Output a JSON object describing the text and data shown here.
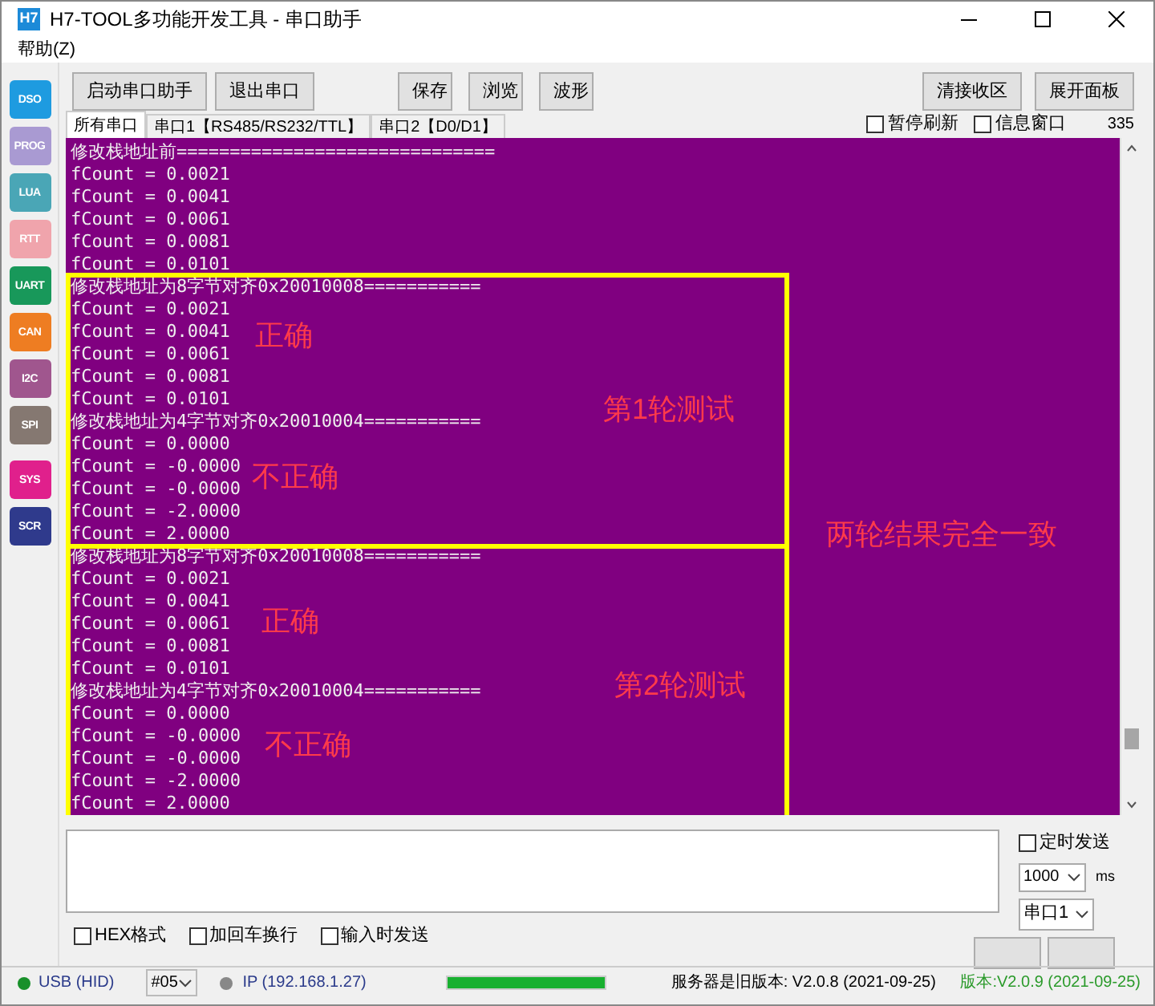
{
  "window": {
    "icon_text": "H7",
    "title": "H7-TOOL多功能开发工具 - 串口助手"
  },
  "menu": [
    "帮助(Z)"
  ],
  "sidebar": [
    {
      "label": "DSO",
      "color": "#1e9be0"
    },
    {
      "label": "PROG",
      "color": "#a99ad2"
    },
    {
      "label": "LUA",
      "color": "#4aa6b6"
    },
    {
      "label": "RTT",
      "color": "#f0a4ac"
    },
    {
      "label": "UART",
      "color": "#18985a"
    },
    {
      "label": "CAN",
      "color": "#ee7d22"
    },
    {
      "label": "I2C",
      "color": "#a0568e"
    },
    {
      "label": "SPI",
      "color": "#857871"
    },
    {
      "label": "SYS",
      "color": "#e0208c"
    },
    {
      "label": "SCR",
      "color": "#2f3a8c"
    }
  ],
  "toolbar": {
    "left": [
      "启动串口助手",
      "退出串口"
    ],
    "middle": [
      "保存",
      "浏览",
      "波形"
    ],
    "right": [
      "清接收区",
      "展开面板"
    ]
  },
  "tabs": [
    {
      "label": "所有串口",
      "selected": true
    },
    {
      "label": "串口1【RS485/RS232/TTL】",
      "selected": false
    },
    {
      "label": "串口2【D0/D1】",
      "selected": false
    }
  ],
  "view_options": [
    {
      "label": "暂停刷新",
      "checked": false
    },
    {
      "label": "信息窗口",
      "checked": false
    }
  ],
  "counter": "335",
  "terminal": {
    "lines": [
      "修改栈地址前==============================",
      "fCount = 0.0021",
      "fCount = 0.0041",
      "fCount = 0.0061",
      "fCount = 0.0081",
      "fCount = 0.0101",
      "修改栈地址为8字节对齐0x20010008===========",
      "fCount = 0.0021",
      "fCount = 0.0041",
      "fCount = 0.0061",
      "fCount = 0.0081",
      "fCount = 0.0101",
      "修改栈地址为4字节对齐0x20010004===========",
      "fCount = 0.0000",
      "fCount = -0.0000",
      "fCount = -0.0000",
      "fCount = -2.0000",
      "fCount = 2.0000",
      "修改栈地址为8字节对齐0x20010008===========",
      "fCount = 0.0021",
      "fCount = 0.0041",
      "fCount = 0.0061",
      "fCount = 0.0081",
      "fCount = 0.0101",
      "修改栈地址为4字节对齐0x20010004===========",
      "fCount = 0.0000",
      "fCount = -0.0000",
      "fCount = -0.0000",
      "fCount = -2.0000",
      "fCount = 2.0000"
    ],
    "annotations": [
      "正确",
      "第1轮测试",
      "不正确",
      "两轮结果完全一致",
      "正确",
      "第2轮测试",
      "不正确"
    ]
  },
  "send": {
    "timer": {
      "label": "定时发送",
      "checked": false
    },
    "interval": "1000",
    "unit": "ms",
    "port": "串口1"
  },
  "send_options": [
    {
      "label": "HEX格式",
      "checked": false
    },
    {
      "label": "加回车换行",
      "checked": false
    },
    {
      "label": "输入时发送",
      "checked": false
    }
  ],
  "status_bar": {
    "usb": {
      "label": "USB (HID)",
      "connected": true
    },
    "device": "#05",
    "ip": {
      "label": "IP (192.168.1.27)",
      "connected": false
    },
    "progress": {
      "level": 1
    },
    "server_version": "服务器是旧版本: V2.0.8 (2021-09-25)",
    "client_version": "版本:V2.0.9 (2021-09-25)"
  }
}
